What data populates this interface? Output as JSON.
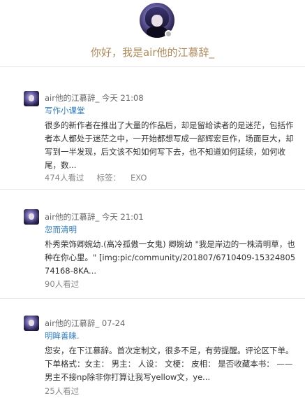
{
  "profile": {
    "greeting": "你好，我是air他的江慕辞_",
    "avatar_icon": "profile-avatar",
    "badge_icon": "level-badge-icon"
  },
  "posts": [
    {
      "author": "air他的江慕辞_",
      "time": "今天 21:08",
      "title": "写作小课堂",
      "body": "很多的新作者在推出了大量的作品后，却是留给读者的是迷茫，包括作者本人都处于迷茫之中，一开始都想写成一部辉宏巨作，场面巨大，却写到一半发现，后文该不知如何写下去，也不知道如何延续，如何收尾，数...",
      "views": "474人看过",
      "tag_label": "标签：",
      "tag_value": "EXO"
    },
    {
      "author": "air他的江慕辞_",
      "time": "今天 21:01",
      "title": "忽而清明",
      "body": "朴秀荣饰卿婉幼.(高冷孤傲一女鬼) 卿婉幼 \"我是岸边的一株清明草，也种在你心里。\" [img:pic/community/201807/6710409-1532480574168-8KA...",
      "views": "90人看过"
    },
    {
      "author": "air他的江慕辞_",
      "time": "07-24",
      "title": "明眸善睐.",
      "body": "您安，在下江慕辞。首次定制文，很多不足，有劳提醒。评论区下单。 下单格式：女主： 男主： 人设： 文梗： 皮相： 是否收藏本书： —— 男主不接np除非你打算让我写yellow文，ye...",
      "views": "25人看过"
    }
  ]
}
